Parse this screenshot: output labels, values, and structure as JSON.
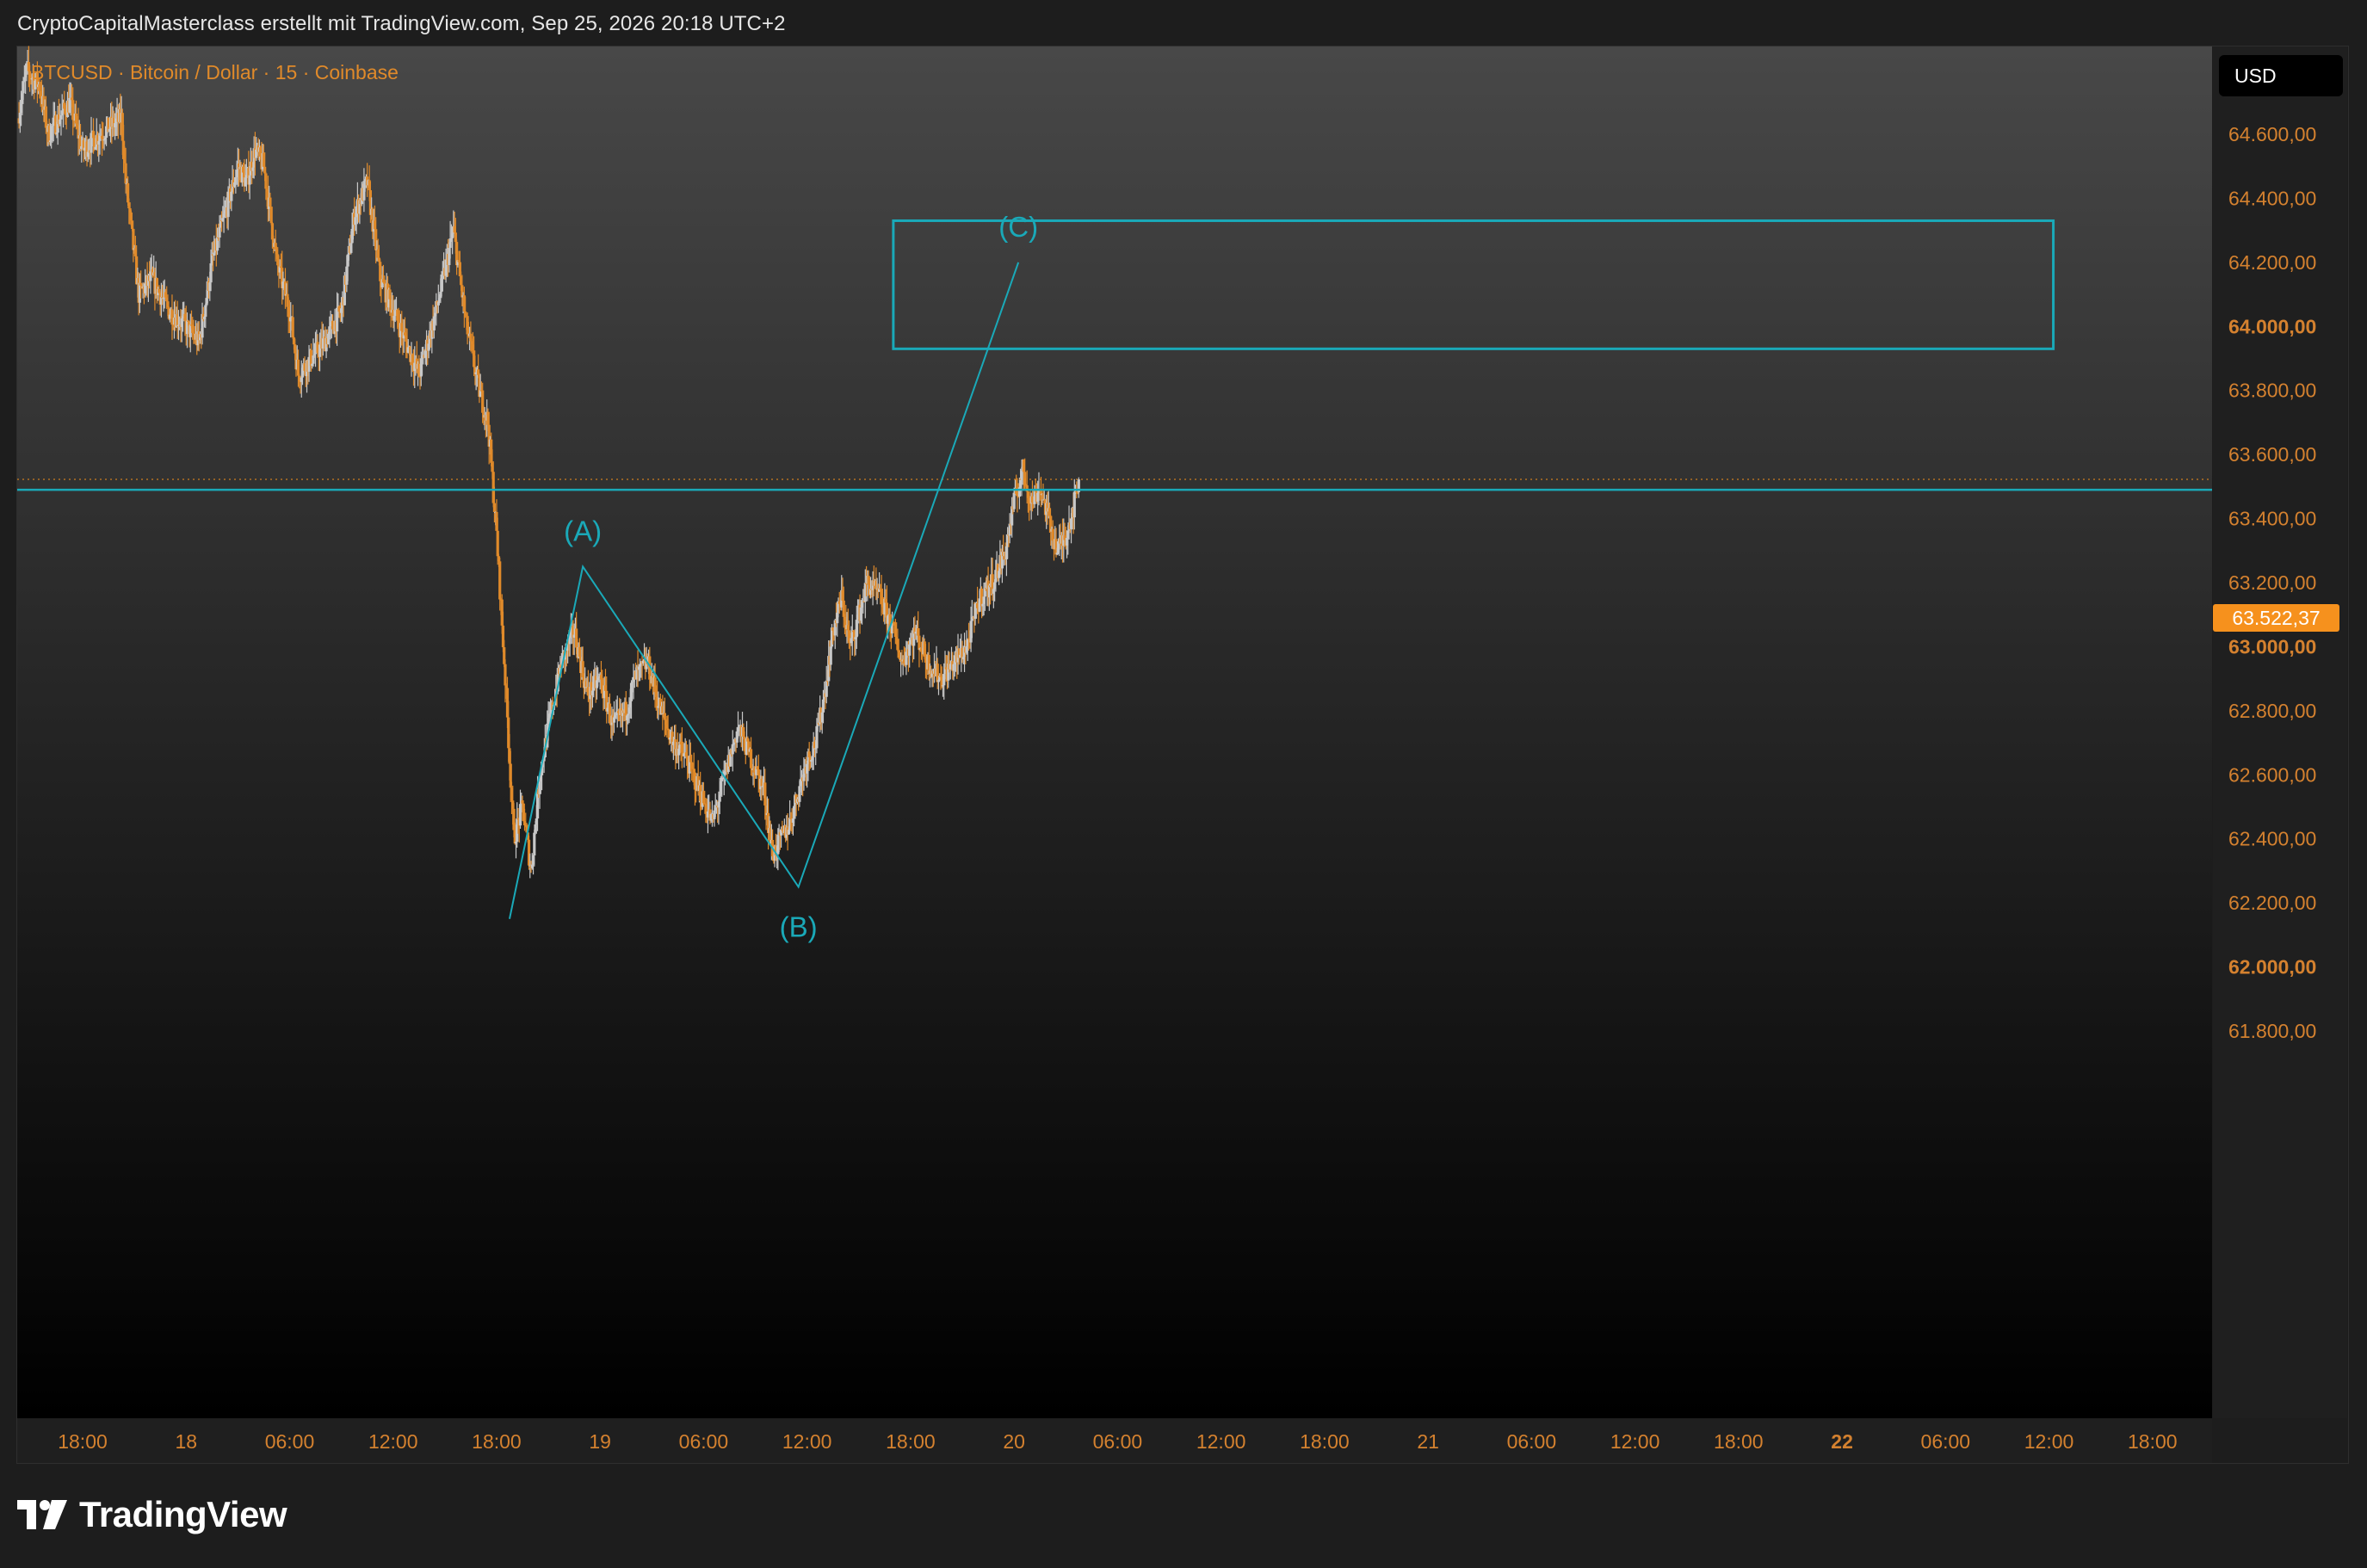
{
  "header": {
    "attribution": "CryptoCapitalMasterclass erstellt mit TradingView.com, Sep 25, 2026 20:18 UTC+2"
  },
  "symbol": {
    "label": "BTCUSD · Bitcoin / Dollar · 15 · Coinbase"
  },
  "currency": "USD",
  "price_tag": "63.522,37",
  "brand": {
    "name": "TradingView",
    "logo_icon": "tradingview-logo-icon"
  },
  "colors": {
    "background_top": "#484848",
    "background_bottom": "#000000",
    "up_candle": "#c8c8c8",
    "down_candle": "#e08a2a",
    "annotation": "#1aa9b8",
    "axis_text": "#d4812f",
    "price_tag": "#f6911d"
  },
  "chart_data": {
    "type": "candlestick",
    "symbol": "BTCUSD",
    "timeframe": "15",
    "exchange": "Coinbase",
    "ylim": [
      61700,
      64900
    ],
    "y_ticks": [
      {
        "value": 64600,
        "label": "64.600,00",
        "bold": false
      },
      {
        "value": 64400,
        "label": "64.400,00",
        "bold": false
      },
      {
        "value": 64200,
        "label": "64.200,00",
        "bold": false
      },
      {
        "value": 64000,
        "label": "64.000,00",
        "bold": true
      },
      {
        "value": 63800,
        "label": "63.800,00",
        "bold": false
      },
      {
        "value": 63600,
        "label": "63.600,00",
        "bold": false
      },
      {
        "value": 63400,
        "label": "63.400,00",
        "bold": false
      },
      {
        "value": 63200,
        "label": "63.200,00",
        "bold": false
      },
      {
        "value": 63000,
        "label": "63.000,00",
        "bold": true
      },
      {
        "value": 62800,
        "label": "62.800,00",
        "bold": false
      },
      {
        "value": 62600,
        "label": "62.600,00",
        "bold": false
      },
      {
        "value": 62400,
        "label": "62.400,00",
        "bold": false
      },
      {
        "value": 62200,
        "label": "62.200,00",
        "bold": false
      },
      {
        "value": 62000,
        "label": "62.000,00",
        "bold": true
      },
      {
        "value": 61800,
        "label": "61.800,00",
        "bold": false
      }
    ],
    "x_ticks": [
      {
        "label": "18:00",
        "bold": false,
        "t": 0
      },
      {
        "label": "18",
        "bold": false,
        "t": 24
      },
      {
        "label": "06:00",
        "bold": false,
        "t": 48
      },
      {
        "label": "12:00",
        "bold": false,
        "t": 72
      },
      {
        "label": "18:00",
        "bold": false,
        "t": 96
      },
      {
        "label": "19",
        "bold": false,
        "t": 120
      },
      {
        "label": "06:00",
        "bold": false,
        "t": 144
      },
      {
        "label": "12:00",
        "bold": false,
        "t": 168
      },
      {
        "label": "18:00",
        "bold": false,
        "t": 192
      },
      {
        "label": "20",
        "bold": false,
        "t": 216
      },
      {
        "label": "06:00",
        "bold": false,
        "t": 240
      },
      {
        "label": "12:00",
        "bold": false,
        "t": 264
      },
      {
        "label": "18:00",
        "bold": false,
        "t": 288
      },
      {
        "label": "21",
        "bold": false,
        "t": 312
      },
      {
        "label": "06:00",
        "bold": false,
        "t": 336
      },
      {
        "label": "12:00",
        "bold": false,
        "t": 360
      },
      {
        "label": "18:00",
        "bold": false,
        "t": 384
      },
      {
        "label": "22",
        "bold": true,
        "t": 408
      },
      {
        "label": "06:00",
        "bold": false,
        "t": 432
      },
      {
        "label": "12:00",
        "bold": false,
        "t": 456
      },
      {
        "label": "18:00",
        "bold": false,
        "t": 480
      }
    ],
    "close_path": [
      [
        -15,
        64650
      ],
      [
        -13,
        64800
      ],
      [
        -10,
        64750
      ],
      [
        -8,
        64600
      ],
      [
        -3,
        64700
      ],
      [
        0,
        64550
      ],
      [
        4,
        64600
      ],
      [
        9,
        64650
      ],
      [
        10,
        64450
      ],
      [
        13,
        64100
      ],
      [
        16,
        64150
      ],
      [
        20,
        64050
      ],
      [
        24,
        64000
      ],
      [
        27,
        63950
      ],
      [
        30,
        64200
      ],
      [
        33,
        64350
      ],
      [
        36,
        64500
      ],
      [
        38,
        64450
      ],
      [
        40,
        64550
      ],
      [
        42,
        64500
      ],
      [
        45,
        64200
      ],
      [
        48,
        64050
      ],
      [
        50,
        63850
      ],
      [
        53,
        63900
      ],
      [
        56,
        63950
      ],
      [
        60,
        64050
      ],
      [
        63,
        64350
      ],
      [
        66,
        64450
      ],
      [
        69,
        64150
      ],
      [
        72,
        64050
      ],
      [
        75,
        63950
      ],
      [
        78,
        63850
      ],
      [
        82,
        64050
      ],
      [
        86,
        64300
      ],
      [
        89,
        64000
      ],
      [
        92,
        63800
      ],
      [
        94,
        63700
      ],
      [
        96,
        63350
      ],
      [
        98,
        62900
      ],
      [
        100,
        62400
      ],
      [
        102,
        62500
      ],
      [
        104,
        62300
      ],
      [
        106,
        62600
      ],
      [
        108,
        62750
      ],
      [
        111,
        62950
      ],
      [
        114,
        63050
      ],
      [
        117,
        62850
      ],
      [
        120,
        62900
      ],
      [
        123,
        62750
      ],
      [
        126,
        62800
      ],
      [
        128,
        62900
      ],
      [
        131,
        62950
      ],
      [
        134,
        62800
      ],
      [
        137,
        62700
      ],
      [
        140,
        62650
      ],
      [
        143,
        62550
      ],
      [
        146,
        62450
      ],
      [
        149,
        62600
      ],
      [
        152,
        62750
      ],
      [
        155,
        62650
      ],
      [
        158,
        62550
      ],
      [
        160,
        62350
      ],
      [
        162,
        62400
      ],
      [
        164,
        62450
      ],
      [
        166,
        62550
      ],
      [
        168,
        62650
      ],
      [
        170,
        62700
      ],
      [
        172,
        62850
      ],
      [
        174,
        63050
      ],
      [
        176,
        63150
      ],
      [
        178,
        63000
      ],
      [
        180,
        63100
      ],
      [
        182,
        63200
      ],
      [
        185,
        63150
      ],
      [
        188,
        63050
      ],
      [
        190,
        62950
      ],
      [
        193,
        63050
      ],
      [
        196,
        62950
      ],
      [
        199,
        62900
      ],
      [
        202,
        62950
      ],
      [
        205,
        63000
      ],
      [
        208,
        63150
      ],
      [
        211,
        63200
      ],
      [
        214,
        63300
      ],
      [
        216,
        63450
      ],
      [
        218,
        63550
      ],
      [
        220,
        63450
      ],
      [
        222,
        63500
      ],
      [
        224,
        63400
      ],
      [
        226,
        63300
      ],
      [
        228,
        63350
      ],
      [
        230,
        63450
      ],
      [
        231,
        63520
      ]
    ],
    "wave_path": [
      {
        "t": 99,
        "price": 62150
      },
      {
        "t": 116,
        "price": 63250
      },
      {
        "t": 166,
        "price": 62250
      },
      {
        "t": 217,
        "price": 64200
      }
    ],
    "wave_labels": [
      {
        "text": "(A)",
        "t": 116,
        "price": 63250,
        "position": "above"
      },
      {
        "text": "(B)",
        "t": 166,
        "price": 62250,
        "position": "below"
      },
      {
        "text": "(C)",
        "t": 217,
        "price": 64200,
        "position": "above"
      }
    ],
    "target_box": {
      "t_start": 188,
      "t_end": 457,
      "price_low": 63930,
      "price_high": 64330
    },
    "horizontal_level": 63490,
    "last_price": 63522.37
  }
}
